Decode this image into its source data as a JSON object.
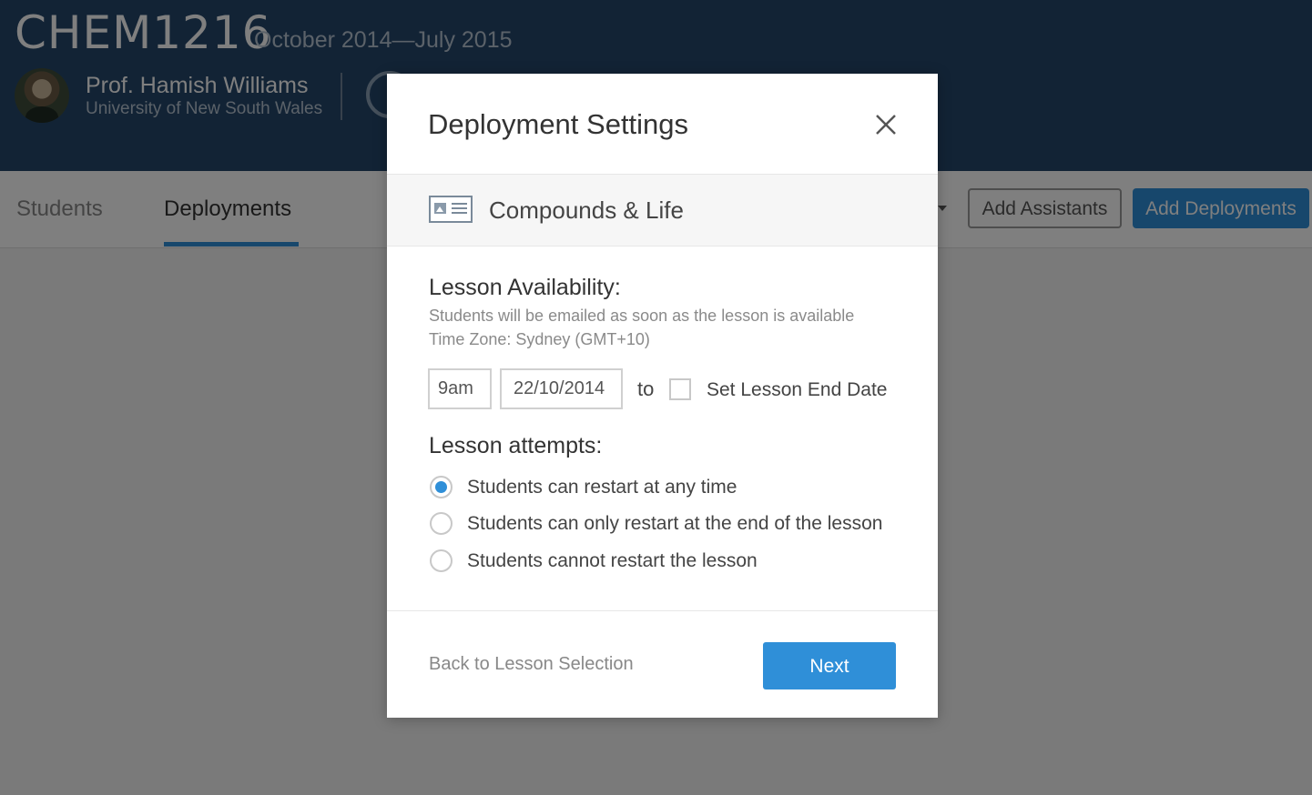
{
  "header": {
    "course_code": "CHEM1216",
    "course_dates": "October 2014—July 2015",
    "professor_name": "Prof. Hamish Williams",
    "university": "University of New South Wales"
  },
  "tabs": [
    {
      "label": "Students",
      "active": false
    },
    {
      "label": "Deployments",
      "active": true
    }
  ],
  "toolbar": {
    "add_assistants_label": "Add Assistants",
    "add_deployments_label": "Add Deployments"
  },
  "modal": {
    "title": "Deployment Settings",
    "lesson_name": "Compounds & Life",
    "availability": {
      "heading": "Lesson Availability:",
      "help_email": "Students will be emailed as soon as the lesson is available",
      "help_timezone": "Time Zone: Sydney (GMT+10)",
      "start_time": "9am",
      "start_date": "22/10/2014",
      "to_label": "to",
      "end_date_checkbox_label": "Set Lesson End Date",
      "end_date_checked": false
    },
    "attempts": {
      "heading": "Lesson attempts:",
      "options": [
        {
          "label": "Students can restart at any time",
          "selected": true
        },
        {
          "label": "Students can only restart at the end of the lesson",
          "selected": false
        },
        {
          "label": "Students cannot restart the lesson",
          "selected": false
        }
      ]
    },
    "footer": {
      "back_label": "Back to Lesson Selection",
      "next_label": "Next"
    }
  },
  "colors": {
    "header_bg": "#24466b",
    "accent": "#2f8fd8"
  }
}
